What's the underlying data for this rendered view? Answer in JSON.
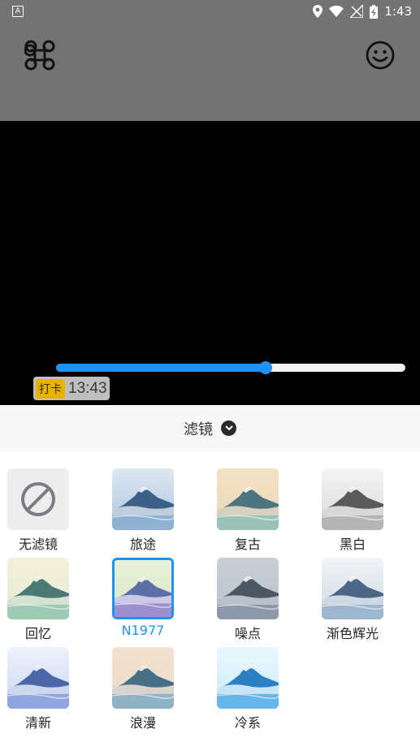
{
  "status_bar": {
    "app_icon_letter": "A",
    "time": "1:43",
    "icons": [
      "location-icon",
      "wifi-icon",
      "no-signal-icon",
      "battery-charging-icon"
    ]
  },
  "toolbar": {
    "left_icon": "command-icon",
    "right_icon": "smiley-icon"
  },
  "preview": {
    "slider_value": 0.6,
    "stamp_badge": "打卡",
    "stamp_time": "13:43"
  },
  "filter_panel": {
    "title": "滤镜",
    "toggle_icon": "chevron-down-icon",
    "selected_color": "#1f93f5",
    "items": [
      {
        "label": "无滤镜",
        "tone": "none"
      },
      {
        "label": "旅途",
        "tone": "journey"
      },
      {
        "label": "复古",
        "tone": "retro"
      },
      {
        "label": "黑白",
        "tone": "bw"
      },
      {
        "label": "回忆",
        "tone": "memory"
      },
      {
        "label": "N1977",
        "tone": "n1977",
        "selected": true
      },
      {
        "label": "噪点",
        "tone": "noise"
      },
      {
        "label": "渐色辉光",
        "tone": "glow"
      },
      {
        "label": "清新",
        "tone": "fresh"
      },
      {
        "label": "浪漫",
        "tone": "romance"
      },
      {
        "label": "冷系",
        "tone": "cool"
      }
    ]
  }
}
